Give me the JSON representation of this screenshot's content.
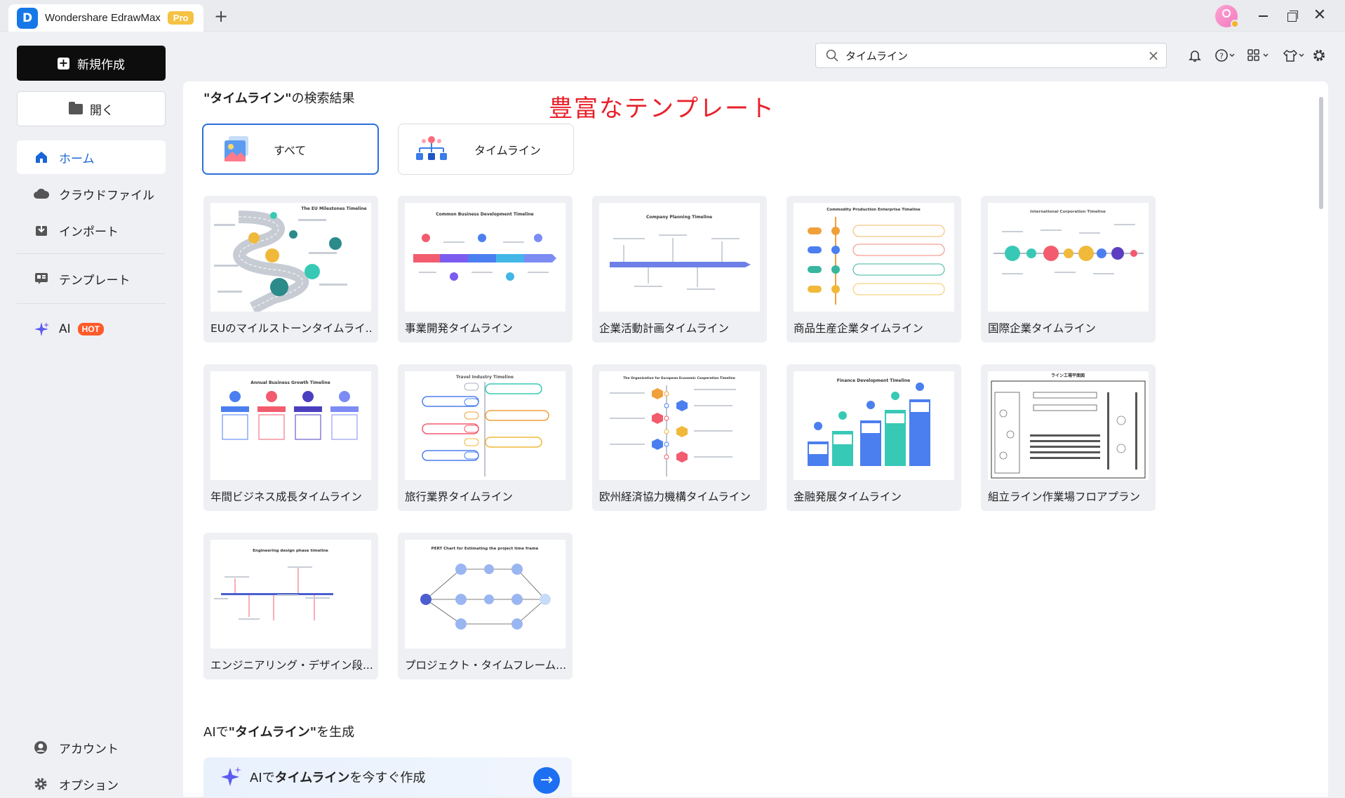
{
  "titlebar": {
    "app_name": "Wondershare EdrawMax",
    "badge": "Pro",
    "new_tab": "+",
    "close": "✕"
  },
  "sidebar": {
    "new_label": "新規作成",
    "open_label": "開く",
    "items": [
      {
        "label": "ホーム",
        "icon": "home-icon",
        "active": true
      },
      {
        "label": "クラウドファイル",
        "icon": "cloud-icon"
      },
      {
        "label": "インポート",
        "icon": "import-icon"
      },
      {
        "label": "テンプレート",
        "icon": "template-icon"
      },
      {
        "label": "AI",
        "icon": "ai-sparkle-icon",
        "badge": "HOT"
      }
    ],
    "bottom": [
      {
        "label": "アカウント",
        "icon": "account-icon"
      },
      {
        "label": "オプション",
        "icon": "gear-icon"
      }
    ]
  },
  "search": {
    "value": "タイムライン"
  },
  "results": {
    "query": "\"タイムライン\"",
    "suffix": "の検索結果",
    "promo": "豊富なテンプレート",
    "filters": [
      {
        "label": "すべて",
        "selected": true
      },
      {
        "label": "タイムライン",
        "selected": false
      }
    ]
  },
  "templates": [
    {
      "label": "EUのマイルストーンタイムライ...",
      "title": "The EU Milestones Timeline"
    },
    {
      "label": "事業開発タイムライン",
      "title": "Common Business Development Timeline"
    },
    {
      "label": "企業活動計画タイムライン",
      "title": "Company Planning Timeline"
    },
    {
      "label": "商品生産企業タイムライン",
      "title": "Commodity Production Enterprise Timeline"
    },
    {
      "label": "国際企業タイムライン",
      "title": "International Corporation Timeline"
    },
    {
      "label": "年間ビジネス成長タイムライン",
      "title": "Annual Business Growth Timeline"
    },
    {
      "label": "旅行業界タイムライン",
      "title": "Travel Industry Timeline"
    },
    {
      "label": "欧州経済協力機構タイムライン",
      "title": "The Organization for European Economic Cooperation Timeline"
    },
    {
      "label": "金融発展タイムライン",
      "title": "Finance Development Timeline"
    },
    {
      "label": "組立ライン作業場フロアプラン",
      "title": "ライン工場平面図"
    },
    {
      "label": "エンジニアリング・デザイン段...",
      "title": "Engineering design phase timeline"
    },
    {
      "label": "プロジェクト・タイムフレーム...",
      "title": "PERT Chart for Estimating the project time frame"
    }
  ],
  "ai_section": {
    "prefix": "AIで",
    "query": "\"タイムライン\"",
    "suffix": "を生成",
    "bar_prefix": "AIで",
    "bar_query": "タイムライン",
    "bar_suffix": "を今すぐ作成",
    "arrow": "→"
  },
  "colors": {
    "accent": "#2a6fdb",
    "promo": "#e8202a",
    "hot": "#ff5a2a",
    "pro": "#f5c243"
  }
}
